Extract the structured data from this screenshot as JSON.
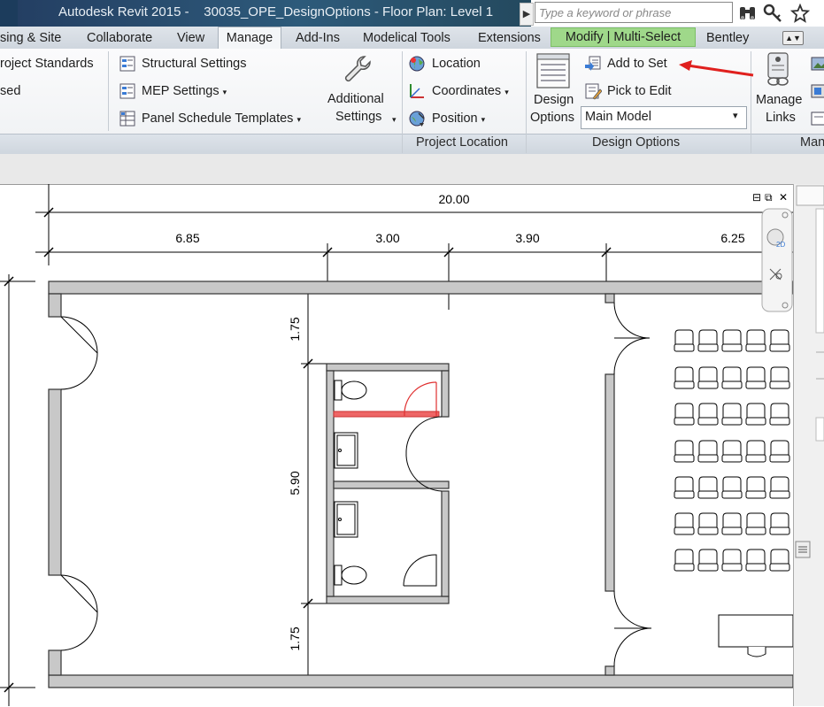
{
  "titlebar": {
    "title": "Autodesk Revit 2015 -    30035_OPE_DesignOptions - Floor Plan: Level 1",
    "search_placeholder": "Type a keyword or phrase",
    "more_arrow": "▶",
    "icons": [
      "binoculars-icon",
      "key-icon",
      "star-icon"
    ]
  },
  "tabs": {
    "items": [
      "sing & Site",
      "Collaborate",
      "View",
      "Manage",
      "Add-Ins",
      "Modelical Tools",
      "Extensions",
      "Modify | Multi-Select",
      "Bentley"
    ],
    "active": "Manage",
    "contextual": "Modify | Multi-Select",
    "caret": "▲▼"
  },
  "ribbon": {
    "settings": {
      "project_standards": "roject Standards",
      "purge": "sed",
      "structural_settings": "Structural  Settings",
      "mep_settings": "MEP  Settings",
      "panel_schedule_templates": "Panel Schedule  Templates",
      "additional_settings_1": "Additional",
      "additional_settings_2": "Settings"
    },
    "project_location": {
      "location": "Location",
      "coordinates": "Coordinates",
      "position": "Position",
      "panel_label": "Project Location"
    },
    "design_options": {
      "design_options_1": "Design",
      "design_options_2": "Options",
      "add_to_set": "Add to Set",
      "pick_to_edit": "Pick to Edit",
      "main_model": "Main Model",
      "panel_label": "Design Options"
    },
    "manage_project": {
      "manage_links_1": "Manage",
      "manage_links_2": "Links",
      "panel_label": "Man"
    },
    "drop_caret": "▾",
    "annotation_arrow_color": "#e0201e"
  },
  "plan": {
    "dimensions": {
      "overall": "20.00",
      "seg1": "6.85",
      "seg2": "3.00",
      "seg3": "3.90",
      "seg4": "6.25",
      "vert_top": "1.75",
      "vert_mid": "5.90",
      "vert_bottom": "1.75"
    },
    "view_controls": {
      "minimize": "⊟",
      "restore": "⧉",
      "close": "✕",
      "nav_2d": "2D"
    }
  },
  "colors": {
    "title_dark": "#243f63",
    "contextual_green": "#9fd88a",
    "wall_fill": "#c8c8c8",
    "selection_red": "#e03030"
  }
}
